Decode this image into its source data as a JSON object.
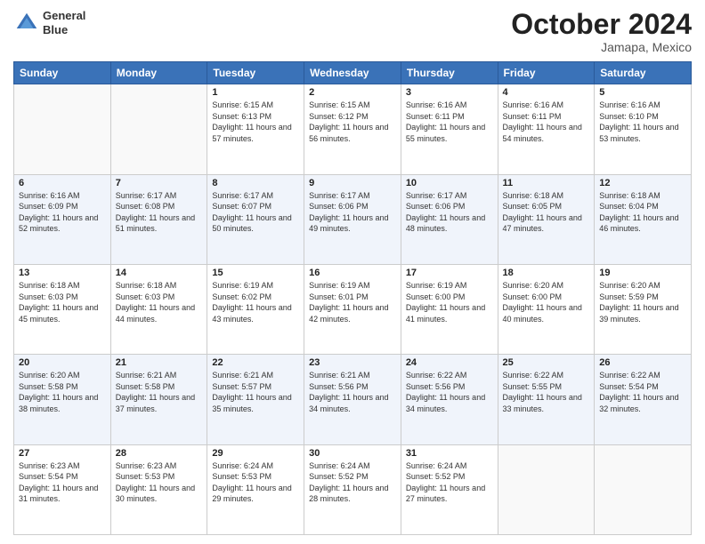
{
  "header": {
    "logo_line1": "General",
    "logo_line2": "Blue",
    "month": "October 2024",
    "location": "Jamapa, Mexico"
  },
  "days_of_week": [
    "Sunday",
    "Monday",
    "Tuesday",
    "Wednesday",
    "Thursday",
    "Friday",
    "Saturday"
  ],
  "weeks": [
    [
      {
        "day": "",
        "sunrise": "",
        "sunset": "",
        "daylight": ""
      },
      {
        "day": "",
        "sunrise": "",
        "sunset": "",
        "daylight": ""
      },
      {
        "day": "1",
        "sunrise": "Sunrise: 6:15 AM",
        "sunset": "Sunset: 6:13 PM",
        "daylight": "Daylight: 11 hours and 57 minutes."
      },
      {
        "day": "2",
        "sunrise": "Sunrise: 6:15 AM",
        "sunset": "Sunset: 6:12 PM",
        "daylight": "Daylight: 11 hours and 56 minutes."
      },
      {
        "day": "3",
        "sunrise": "Sunrise: 6:16 AM",
        "sunset": "Sunset: 6:11 PM",
        "daylight": "Daylight: 11 hours and 55 minutes."
      },
      {
        "day": "4",
        "sunrise": "Sunrise: 6:16 AM",
        "sunset": "Sunset: 6:11 PM",
        "daylight": "Daylight: 11 hours and 54 minutes."
      },
      {
        "day": "5",
        "sunrise": "Sunrise: 6:16 AM",
        "sunset": "Sunset: 6:10 PM",
        "daylight": "Daylight: 11 hours and 53 minutes."
      }
    ],
    [
      {
        "day": "6",
        "sunrise": "Sunrise: 6:16 AM",
        "sunset": "Sunset: 6:09 PM",
        "daylight": "Daylight: 11 hours and 52 minutes."
      },
      {
        "day": "7",
        "sunrise": "Sunrise: 6:17 AM",
        "sunset": "Sunset: 6:08 PM",
        "daylight": "Daylight: 11 hours and 51 minutes."
      },
      {
        "day": "8",
        "sunrise": "Sunrise: 6:17 AM",
        "sunset": "Sunset: 6:07 PM",
        "daylight": "Daylight: 11 hours and 50 minutes."
      },
      {
        "day": "9",
        "sunrise": "Sunrise: 6:17 AM",
        "sunset": "Sunset: 6:06 PM",
        "daylight": "Daylight: 11 hours and 49 minutes."
      },
      {
        "day": "10",
        "sunrise": "Sunrise: 6:17 AM",
        "sunset": "Sunset: 6:06 PM",
        "daylight": "Daylight: 11 hours and 48 minutes."
      },
      {
        "day": "11",
        "sunrise": "Sunrise: 6:18 AM",
        "sunset": "Sunset: 6:05 PM",
        "daylight": "Daylight: 11 hours and 47 minutes."
      },
      {
        "day": "12",
        "sunrise": "Sunrise: 6:18 AM",
        "sunset": "Sunset: 6:04 PM",
        "daylight": "Daylight: 11 hours and 46 minutes."
      }
    ],
    [
      {
        "day": "13",
        "sunrise": "Sunrise: 6:18 AM",
        "sunset": "Sunset: 6:03 PM",
        "daylight": "Daylight: 11 hours and 45 minutes."
      },
      {
        "day": "14",
        "sunrise": "Sunrise: 6:18 AM",
        "sunset": "Sunset: 6:03 PM",
        "daylight": "Daylight: 11 hours and 44 minutes."
      },
      {
        "day": "15",
        "sunrise": "Sunrise: 6:19 AM",
        "sunset": "Sunset: 6:02 PM",
        "daylight": "Daylight: 11 hours and 43 minutes."
      },
      {
        "day": "16",
        "sunrise": "Sunrise: 6:19 AM",
        "sunset": "Sunset: 6:01 PM",
        "daylight": "Daylight: 11 hours and 42 minutes."
      },
      {
        "day": "17",
        "sunrise": "Sunrise: 6:19 AM",
        "sunset": "Sunset: 6:00 PM",
        "daylight": "Daylight: 11 hours and 41 minutes."
      },
      {
        "day": "18",
        "sunrise": "Sunrise: 6:20 AM",
        "sunset": "Sunset: 6:00 PM",
        "daylight": "Daylight: 11 hours and 40 minutes."
      },
      {
        "day": "19",
        "sunrise": "Sunrise: 6:20 AM",
        "sunset": "Sunset: 5:59 PM",
        "daylight": "Daylight: 11 hours and 39 minutes."
      }
    ],
    [
      {
        "day": "20",
        "sunrise": "Sunrise: 6:20 AM",
        "sunset": "Sunset: 5:58 PM",
        "daylight": "Daylight: 11 hours and 38 minutes."
      },
      {
        "day": "21",
        "sunrise": "Sunrise: 6:21 AM",
        "sunset": "Sunset: 5:58 PM",
        "daylight": "Daylight: 11 hours and 37 minutes."
      },
      {
        "day": "22",
        "sunrise": "Sunrise: 6:21 AM",
        "sunset": "Sunset: 5:57 PM",
        "daylight": "Daylight: 11 hours and 35 minutes."
      },
      {
        "day": "23",
        "sunrise": "Sunrise: 6:21 AM",
        "sunset": "Sunset: 5:56 PM",
        "daylight": "Daylight: 11 hours and 34 minutes."
      },
      {
        "day": "24",
        "sunrise": "Sunrise: 6:22 AM",
        "sunset": "Sunset: 5:56 PM",
        "daylight": "Daylight: 11 hours and 34 minutes."
      },
      {
        "day": "25",
        "sunrise": "Sunrise: 6:22 AM",
        "sunset": "Sunset: 5:55 PM",
        "daylight": "Daylight: 11 hours and 33 minutes."
      },
      {
        "day": "26",
        "sunrise": "Sunrise: 6:22 AM",
        "sunset": "Sunset: 5:54 PM",
        "daylight": "Daylight: 11 hours and 32 minutes."
      }
    ],
    [
      {
        "day": "27",
        "sunrise": "Sunrise: 6:23 AM",
        "sunset": "Sunset: 5:54 PM",
        "daylight": "Daylight: 11 hours and 31 minutes."
      },
      {
        "day": "28",
        "sunrise": "Sunrise: 6:23 AM",
        "sunset": "Sunset: 5:53 PM",
        "daylight": "Daylight: 11 hours and 30 minutes."
      },
      {
        "day": "29",
        "sunrise": "Sunrise: 6:24 AM",
        "sunset": "Sunset: 5:53 PM",
        "daylight": "Daylight: 11 hours and 29 minutes."
      },
      {
        "day": "30",
        "sunrise": "Sunrise: 6:24 AM",
        "sunset": "Sunset: 5:52 PM",
        "daylight": "Daylight: 11 hours and 28 minutes."
      },
      {
        "day": "31",
        "sunrise": "Sunrise: 6:24 AM",
        "sunset": "Sunset: 5:52 PM",
        "daylight": "Daylight: 11 hours and 27 minutes."
      },
      {
        "day": "",
        "sunrise": "",
        "sunset": "",
        "daylight": ""
      },
      {
        "day": "",
        "sunrise": "",
        "sunset": "",
        "daylight": ""
      }
    ]
  ]
}
